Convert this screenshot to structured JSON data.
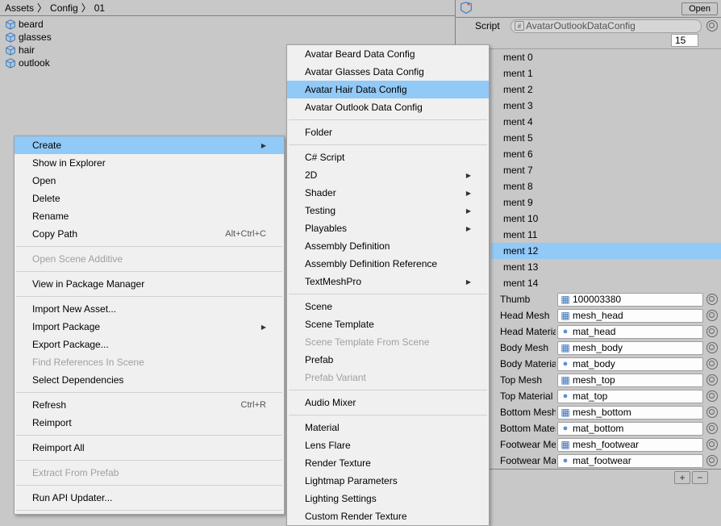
{
  "breadcrumb": [
    "Assets",
    "Config",
    "01"
  ],
  "assets": [
    "beard",
    "glasses",
    "hair",
    "outlook"
  ],
  "open_button": "Open",
  "script_label": "Script",
  "script_value": "AvatarOutlookDataConfig",
  "count_value": "15",
  "ctx1": [
    {
      "t": "item",
      "label": "Create",
      "arrow": true,
      "highlight": true
    },
    {
      "t": "item",
      "label": "Show in Explorer"
    },
    {
      "t": "item",
      "label": "Open"
    },
    {
      "t": "item",
      "label": "Delete"
    },
    {
      "t": "item",
      "label": "Rename"
    },
    {
      "t": "item",
      "label": "Copy Path",
      "shortcut": "Alt+Ctrl+C"
    },
    {
      "t": "sep"
    },
    {
      "t": "item",
      "label": "Open Scene Additive",
      "disabled": true
    },
    {
      "t": "sep"
    },
    {
      "t": "item",
      "label": "View in Package Manager"
    },
    {
      "t": "sep"
    },
    {
      "t": "item",
      "label": "Import New Asset..."
    },
    {
      "t": "item",
      "label": "Import Package",
      "arrow": true
    },
    {
      "t": "item",
      "label": "Export Package..."
    },
    {
      "t": "item",
      "label": "Find References In Scene",
      "disabled": true
    },
    {
      "t": "item",
      "label": "Select Dependencies"
    },
    {
      "t": "sep"
    },
    {
      "t": "item",
      "label": "Refresh",
      "shortcut": "Ctrl+R"
    },
    {
      "t": "item",
      "label": "Reimport"
    },
    {
      "t": "sep"
    },
    {
      "t": "item",
      "label": "Reimport All"
    },
    {
      "t": "sep"
    },
    {
      "t": "item",
      "label": "Extract From Prefab",
      "disabled": true
    },
    {
      "t": "sep"
    },
    {
      "t": "item",
      "label": "Run API Updater..."
    },
    {
      "t": "sep"
    }
  ],
  "ctx2": [
    {
      "t": "item",
      "label": "Avatar Beard Data Config"
    },
    {
      "t": "item",
      "label": "Avatar Glasses Data Config"
    },
    {
      "t": "item",
      "label": "Avatar Hair Data Config",
      "highlight": true
    },
    {
      "t": "item",
      "label": "Avatar Outlook Data Config"
    },
    {
      "t": "sep"
    },
    {
      "t": "item",
      "label": "Folder"
    },
    {
      "t": "sep"
    },
    {
      "t": "item",
      "label": "C# Script"
    },
    {
      "t": "item",
      "label": "2D",
      "arrow": true
    },
    {
      "t": "item",
      "label": "Shader",
      "arrow": true
    },
    {
      "t": "item",
      "label": "Testing",
      "arrow": true
    },
    {
      "t": "item",
      "label": "Playables",
      "arrow": true
    },
    {
      "t": "item",
      "label": "Assembly Definition"
    },
    {
      "t": "item",
      "label": "Assembly Definition Reference"
    },
    {
      "t": "item",
      "label": "TextMeshPro",
      "arrow": true
    },
    {
      "t": "sep"
    },
    {
      "t": "item",
      "label": "Scene"
    },
    {
      "t": "item",
      "label": "Scene Template"
    },
    {
      "t": "item",
      "label": "Scene Template From Scene",
      "disabled": true
    },
    {
      "t": "item",
      "label": "Prefab"
    },
    {
      "t": "item",
      "label": "Prefab Variant",
      "disabled": true
    },
    {
      "t": "sep"
    },
    {
      "t": "item",
      "label": "Audio Mixer"
    },
    {
      "t": "sep"
    },
    {
      "t": "item",
      "label": "Material"
    },
    {
      "t": "item",
      "label": "Lens Flare"
    },
    {
      "t": "item",
      "label": "Render Texture"
    },
    {
      "t": "item",
      "label": "Lightmap Parameters"
    },
    {
      "t": "item",
      "label": "Lighting Settings"
    },
    {
      "t": "item",
      "label": "Custom Render Texture"
    }
  ],
  "elements": [
    {
      "label": "ment 0"
    },
    {
      "label": "ment 1"
    },
    {
      "label": "ment 2"
    },
    {
      "label": "ment 3"
    },
    {
      "label": "ment 4"
    },
    {
      "label": "ment 5"
    },
    {
      "label": "ment 6"
    },
    {
      "label": "ment 7"
    },
    {
      "label": "ment 8"
    },
    {
      "label": "ment 9"
    },
    {
      "label": "ment 10"
    },
    {
      "label": "ment 11"
    },
    {
      "label": "ment 12",
      "sel": true
    },
    {
      "label": "ment 13"
    },
    {
      "label": "ment 14"
    }
  ],
  "props": [
    {
      "label": "Thumb",
      "value": "100003380",
      "icon": "grid"
    },
    {
      "label": "Head Mesh",
      "value": "mesh_head",
      "icon": "grid"
    },
    {
      "label": "Head Materia",
      "value": "mat_head",
      "icon": "sphere"
    },
    {
      "label": "Body Mesh",
      "value": "mesh_body",
      "icon": "grid"
    },
    {
      "label": "Body Materia",
      "value": "mat_body",
      "icon": "sphere"
    },
    {
      "label": "Top Mesh",
      "value": "mesh_top",
      "icon": "grid"
    },
    {
      "label": "Top Material",
      "value": "mat_top",
      "icon": "sphere"
    },
    {
      "label": "Bottom Mesh",
      "value": "mesh_bottom",
      "icon": "grid"
    },
    {
      "label": "Bottom Mater",
      "value": "mat_bottom",
      "icon": "sphere"
    },
    {
      "label": "Footwear Me",
      "value": "mesh_footwear",
      "icon": "grid"
    },
    {
      "label": "Footwear Ma",
      "value": "mat_footwear",
      "icon": "sphere"
    }
  ]
}
